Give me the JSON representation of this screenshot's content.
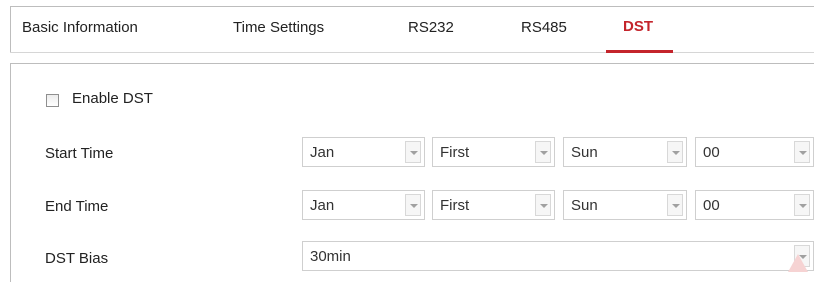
{
  "tabs": [
    {
      "label": "Basic Information"
    },
    {
      "label": "Time Settings"
    },
    {
      "label": "RS232"
    },
    {
      "label": "RS485"
    },
    {
      "label": "DST",
      "active": true
    }
  ],
  "accent_color": "#c4242b",
  "enable_dst": {
    "label": "Enable DST",
    "checked": false
  },
  "start_time": {
    "label": "Start Time",
    "month": "Jan",
    "week": "First",
    "day": "Sun",
    "hour": "00"
  },
  "end_time": {
    "label": "End Time",
    "month": "Jan",
    "week": "First",
    "day": "Sun",
    "hour": "00"
  },
  "dst_bias": {
    "label": "DST Bias",
    "value": "30min"
  }
}
